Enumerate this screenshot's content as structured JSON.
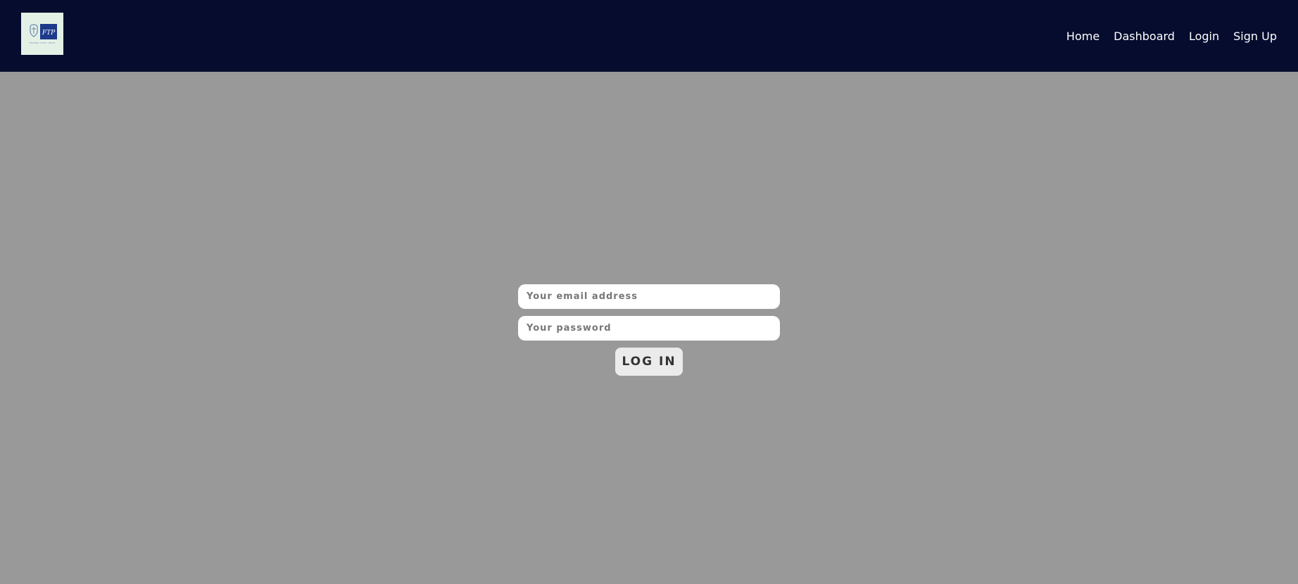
{
  "navbar": {
    "logo": {
      "monogram": "FTP",
      "tagline": "FRIEND THAT TECH",
      "background": "#e3f0e6",
      "brand_color": "#1d3a8a"
    },
    "links": [
      {
        "label": "Home"
      },
      {
        "label": "Dashboard"
      },
      {
        "label": "Login"
      },
      {
        "label": "Sign Up"
      }
    ],
    "background": "#060c2e"
  },
  "login": {
    "email_placeholder": "Your email address",
    "password_placeholder": "Your password",
    "button_label": "LOG IN"
  },
  "colors": {
    "page_background": "#999999",
    "nav_text": "#ffffff"
  }
}
